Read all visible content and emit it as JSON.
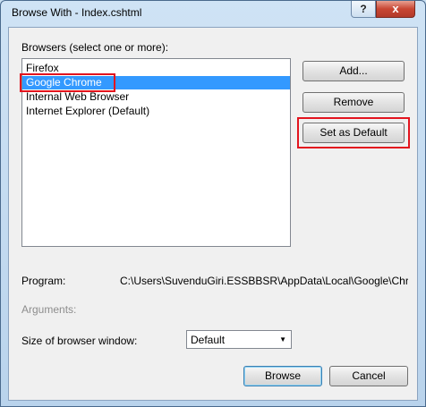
{
  "window": {
    "title": "Browse With - Index.cshtml",
    "help": "?",
    "close": "x"
  },
  "browsers": {
    "label": "Browsers (select one or more):",
    "items": [
      "Firefox",
      "Google Chrome",
      "Internal Web Browser",
      "Internet Explorer (Default)"
    ],
    "selected_index": 1
  },
  "buttons": {
    "add": "Add...",
    "remove": "Remove",
    "set_default": "Set as Default",
    "browse": "Browse",
    "cancel": "Cancel"
  },
  "program": {
    "label": "Program:",
    "value": "C:\\Users\\SuvenduGiri.ESSBBSR\\AppData\\Local\\Google\\Chrome\\Application\\chrome.exe"
  },
  "arguments": {
    "label": "Arguments:"
  },
  "window_size": {
    "label": "Size of browser window:",
    "value": "Default"
  },
  "colors": {
    "highlight": "#e3141e",
    "selection": "#3399ff"
  }
}
